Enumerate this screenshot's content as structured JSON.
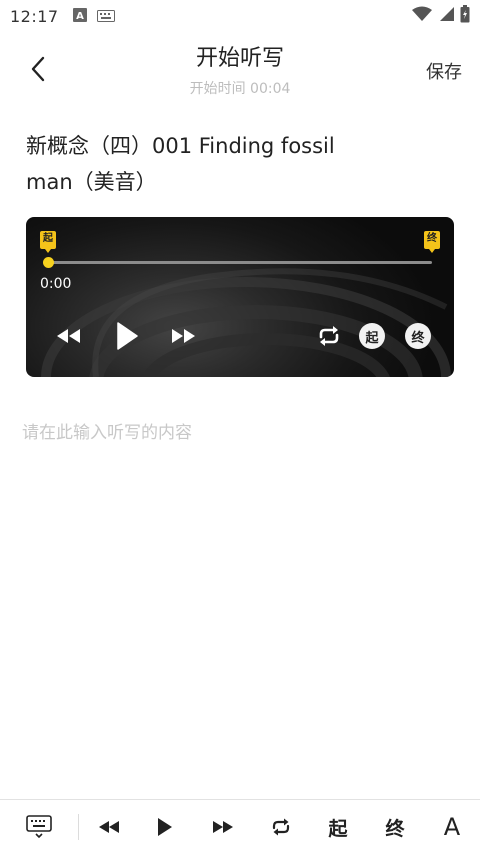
{
  "status_bar": {
    "time": "12:17",
    "icons": [
      "a-box-icon",
      "keyboard-icon",
      "wifi-icon",
      "signal-icon",
      "battery-icon"
    ]
  },
  "header": {
    "title": "开始听写",
    "subtitle": "开始时间 00:04",
    "save_label": "保存",
    "back_icon": "chevron-left-icon"
  },
  "content": {
    "title": "新概念（四）001 Finding fossil man（美音）"
  },
  "player": {
    "start_mark": "起",
    "end_mark": "终",
    "current_time": "0:00",
    "progress": 0,
    "start_label": "起",
    "end_label": "终",
    "accent_color": "#f4c31a"
  },
  "input": {
    "value": "",
    "placeholder": "请在此输入听写的内容"
  },
  "toolbar": {
    "start_label": "起",
    "end_label": "终",
    "font_label": "A"
  }
}
